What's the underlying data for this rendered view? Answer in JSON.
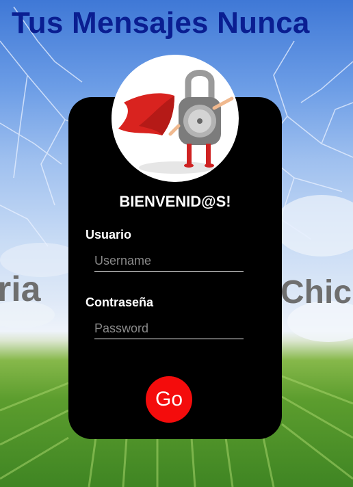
{
  "background": {
    "headline": "Tus Mensajes Nunca",
    "left_word": "ria",
    "right_word": "Chic"
  },
  "login": {
    "welcome": "BIENVENID@S!",
    "username_label": "Usuario",
    "username_placeholder": "Username",
    "username_value": "",
    "password_label": "Contraseña",
    "password_placeholder": "Password",
    "password_value": "",
    "submit_label": "Go"
  },
  "icons": {
    "avatar": "superhero-padlock-icon"
  },
  "colors": {
    "headline": "#0a1e91",
    "card": "#000000",
    "button": "#f40c0c",
    "side_words": "#6e6e6e"
  }
}
